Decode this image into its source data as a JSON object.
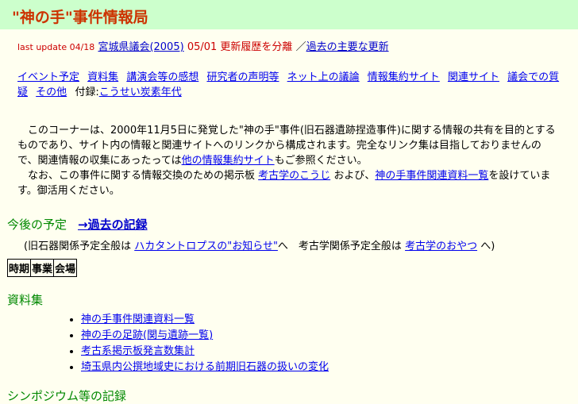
{
  "header": {
    "title": "\"神の手\"事件情報局"
  },
  "update": {
    "prefix": "last update 04/18",
    "link1": "宮城県議会(2005)",
    "text2": "05/01 更新履歴を分離",
    "sep": "／",
    "link2": "過去の主要な更新"
  },
  "nav": {
    "links": [
      "イベント予定",
      "資料集",
      "講演会等の感想",
      "研究者の声明等",
      "ネット上の議論",
      "情報集約サイト",
      "関連サイト",
      "議会での質疑",
      "その他"
    ],
    "appendix_label": "付録:",
    "appendix_link": "こうせい炭素年代"
  },
  "intro": {
    "p1": "このコーナーは、2000年11月5日に発覚した\"神の手\"事件(旧石器遺跡捏造事件)に関する情報の共有を目的とするものであり、サイト内の情報と関連サイトへのリンクから構成されます。完全なリンク集は目指しておりませんので、関連情報の収集にあったっては",
    "p1_link": "他の情報集約サイト",
    "p1_end": "もご参照ください。",
    "p2_a": "なお、この事件に関する情報交換のための掲示板",
    "p2_link1": "考古学のこうじ",
    "p2_b": "および、",
    "p2_link2": "神の手事件関連資料一覧",
    "p2_c": "を設けています。御活用ください。"
  },
  "schedule": {
    "heading": "今後の予定",
    "past_link": "→過去の記録",
    "note_a": "(旧石器関係予定全般は",
    "note_link1": "ハカタントロプスの\"お知らせ\"",
    "note_b": "へ　考古学関係予定全般は",
    "note_link2": "考古学のおやつ",
    "note_c": "へ)",
    "table_headers": [
      "時期",
      "事業",
      "会場"
    ]
  },
  "documents": {
    "heading": "資料集",
    "items": [
      "神の手事件関連資料一覧",
      "神の手の足跡(関与遺跡一覧)",
      "考古系掲示板発言数集計",
      "埼玉県内公撰地域史における前期旧石器の扱いの変化"
    ]
  },
  "next_section": {
    "heading": "シンポジウム等の記録"
  }
}
